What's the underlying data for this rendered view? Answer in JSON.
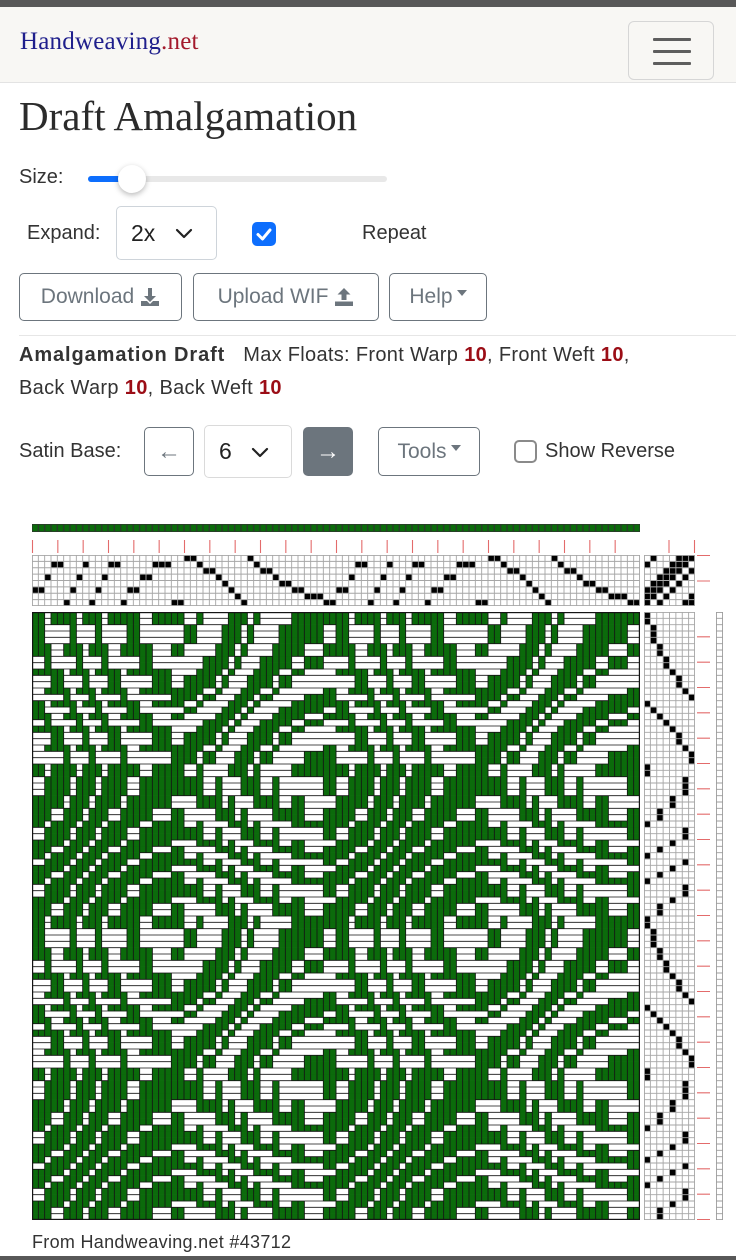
{
  "header": {
    "brand_main": "Handweaving",
    "brand_tld": ".net"
  },
  "page": {
    "title": "Draft Amalgamation"
  },
  "controls": {
    "size_label": "Size:",
    "size_fraction": 0.1,
    "expand_label": "Expand:",
    "expand_value": "2x",
    "repeat_checked": true,
    "repeat_label": "Repeat",
    "download_label": "Download",
    "upload_label": "Upload WIF",
    "help_label": "Help"
  },
  "summary": {
    "title": "Amalgamation Draft",
    "max_floats_label": "Max Floats:",
    "sep": ",",
    "floats": [
      {
        "label": "Front Warp",
        "value": "10"
      },
      {
        "label": "Front Weft",
        "value": "10"
      },
      {
        "label": "Back Warp",
        "value": "10"
      },
      {
        "label": "Back Weft",
        "value": "10"
      }
    ]
  },
  "satin": {
    "label": "Satin Base:",
    "prev_label": "←",
    "value": "6",
    "next_label": "→",
    "tools_label": "Tools",
    "show_reverse_label": "Show Reverse",
    "show_reverse_checked": false
  },
  "draft": {
    "shafts": 8,
    "treadles": 8,
    "warp_color": "#0b6b0b",
    "weft_color": "#ffffff",
    "tick_color": "#e36b6b",
    "threading": [
      3,
      3,
      5,
      7,
      7,
      1,
      3,
      5,
      7,
      1,
      3,
      5,
      7,
      7,
      1,
      3,
      3,
      5,
      5,
      7,
      7,
      7,
      1,
      1,
      8,
      8,
      7,
      6,
      6,
      5,
      4,
      3,
      2,
      1,
      8,
      7,
      6,
      6,
      5,
      4,
      4,
      3,
      3,
      2,
      2,
      2,
      1,
      1,
      3,
      3,
      5,
      7,
      7,
      1,
      3,
      5,
      7,
      1,
      3,
      5,
      7,
      7,
      1,
      3,
      3,
      5,
      5,
      7,
      7,
      7,
      1,
      1,
      8,
      8,
      7,
      6,
      6,
      5,
      4,
      3,
      2,
      1,
      8,
      7,
      6,
      6,
      5,
      4,
      4,
      3,
      3,
      2,
      2,
      2,
      1,
      1
    ],
    "tieup": [
      "10100011",
      "11010001",
      "11101000",
      "01110100",
      "00111010",
      "00011101",
      "10001110",
      "01000111"
    ],
    "treadling": [
      1,
      1,
      2,
      2,
      2,
      3,
      3,
      4,
      4,
      5,
      6,
      6,
      7,
      8,
      1,
      2,
      3,
      4,
      5,
      6,
      6,
      7,
      8,
      8,
      1,
      1,
      7,
      7,
      7,
      5,
      5,
      3,
      3,
      1,
      7,
      7,
      5,
      3,
      1,
      7,
      5,
      3,
      1,
      7,
      7,
      5,
      3,
      3,
      1,
      1,
      2,
      2,
      2,
      3,
      3,
      4,
      4,
      5,
      6,
      6,
      7,
      8,
      1,
      2,
      3,
      4,
      5,
      6,
      6,
      7,
      8,
      8,
      1,
      1,
      7,
      7,
      7,
      5,
      5,
      3,
      3,
      1,
      7,
      7,
      5,
      3,
      1,
      7,
      5,
      3,
      1,
      7,
      7,
      5,
      3,
      3
    ]
  },
  "footer": {
    "credit": "From Handweaving.net #43712"
  }
}
